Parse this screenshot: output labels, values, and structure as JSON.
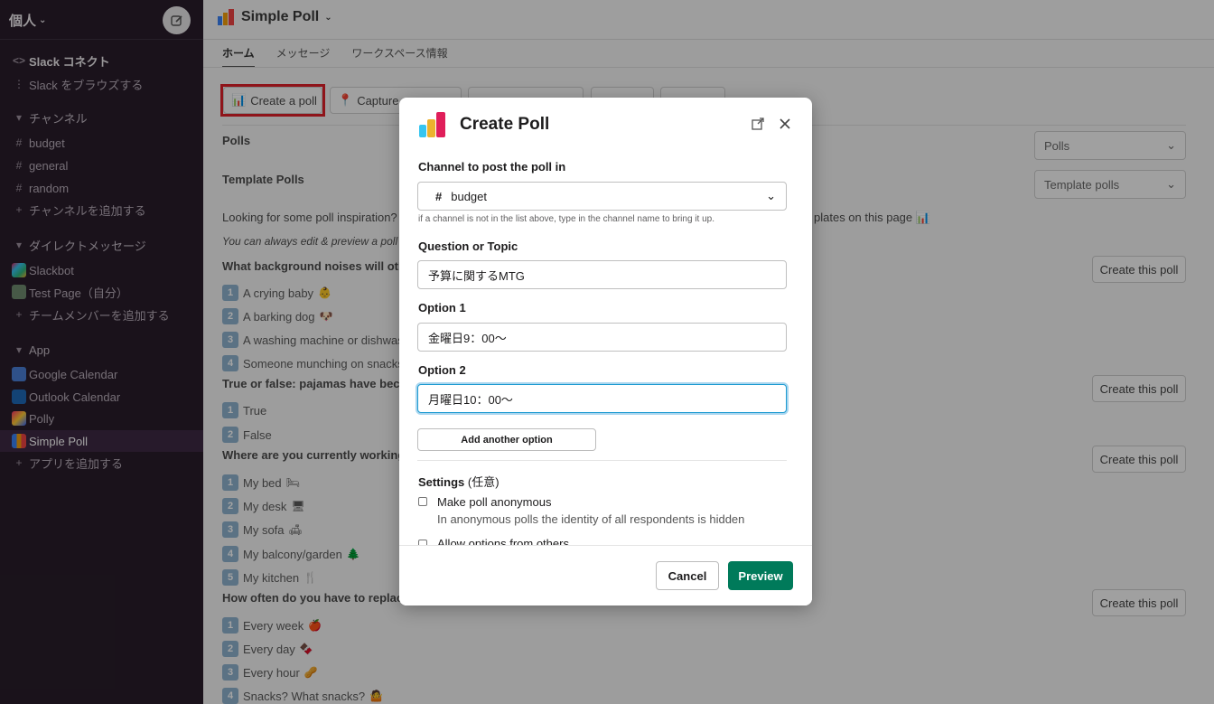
{
  "sidebar": {
    "workspace": "個人",
    "connect": {
      "title": "Slack コネクト",
      "browse": "Slack をブラウズする"
    },
    "channels_header": "チャンネル",
    "channels": [
      "budget",
      "general",
      "random"
    ],
    "add_channel": "チャンネルを追加する",
    "dm_header": "ダイレクトメッセージ",
    "dms": [
      "Slackbot",
      "Test Page（自分）"
    ],
    "add_member": "チームメンバーを追加する",
    "app_header": "App",
    "apps": [
      "Google Calendar",
      "Outlook Calendar",
      "Polly",
      "Simple Poll"
    ],
    "add_app": "アプリを追加する"
  },
  "main": {
    "title": "Simple Poll",
    "tabs": [
      "ホーム",
      "メッセージ",
      "ワークスペース情報"
    ],
    "toolbar": [
      "Create a poll",
      "Capture",
      "",
      "",
      "",
      ""
    ],
    "polls_label": "Polls",
    "polls_select": "Polls",
    "template_label": "Template Polls",
    "template_select": "Template polls",
    "inspiration": "Looking for some poll inspiration?",
    "inspiration_tail": "plates on this page",
    "edit_note": "You can always edit & preview a poll",
    "create_this_poll": "Create this poll",
    "questions": [
      {
        "q": "What background noises will othe",
        "options": [
          {
            "n": "1",
            "t": "A crying baby",
            "e": "👶"
          },
          {
            "n": "2",
            "t": "A barking dog",
            "e": "🐶"
          },
          {
            "n": "3",
            "t": "A washing machine or dishwas",
            "e": ""
          },
          {
            "n": "4",
            "t": "Someone munching on snacks",
            "e": ""
          }
        ]
      },
      {
        "q": "True or false: pajamas have becom",
        "options": [
          {
            "n": "1",
            "t": "True",
            "e": ""
          },
          {
            "n": "2",
            "t": "False",
            "e": ""
          }
        ]
      },
      {
        "q": "Where are you currently working",
        "options": [
          {
            "n": "1",
            "t": "My bed",
            "e": "🛏"
          },
          {
            "n": "2",
            "t": "My desk",
            "e": "🖥"
          },
          {
            "n": "3",
            "t": "My sofa",
            "e": "🛋"
          },
          {
            "n": "4",
            "t": "My balcony/garden",
            "e": "🌲"
          },
          {
            "n": "5",
            "t": "My kitchen",
            "e": "🍴"
          }
        ]
      },
      {
        "q": "How often do you have to replace",
        "options": [
          {
            "n": "1",
            "t": "Every week",
            "e": "🍎"
          },
          {
            "n": "2",
            "t": "Every day",
            "e": "🍫"
          },
          {
            "n": "3",
            "t": "Every hour",
            "e": "🥜"
          },
          {
            "n": "4",
            "t": "Snacks? What snacks?",
            "e": "🤷"
          }
        ]
      }
    ]
  },
  "modal": {
    "title": "Create Poll",
    "channel_label": "Channel to post the poll in",
    "channel_value": "budget",
    "channel_hint": "if a channel is not in the list above, type in the channel name to bring it up.",
    "question_label": "Question or Topic",
    "question_value": "予算に関するMTG",
    "option1_label": "Option 1",
    "option1_value": "金曜日9：00〜",
    "option2_label": "Option 2",
    "option2_value": "月曜日10：00〜",
    "add_option": "Add another option",
    "settings_label": "Settings",
    "settings_optional": "(任意)",
    "anon_label": "Make poll anonymous",
    "anon_desc": "In anonymous polls the identity of all respondents is hidden",
    "allow_label": "Allow options from others",
    "cancel": "Cancel",
    "preview": "Preview"
  },
  "colors": {
    "sidebar_bg": "#291d2b",
    "preview_green": "#007a5a",
    "highlight_red": "#e0202a",
    "focus_blue": "#1d9bd1"
  }
}
